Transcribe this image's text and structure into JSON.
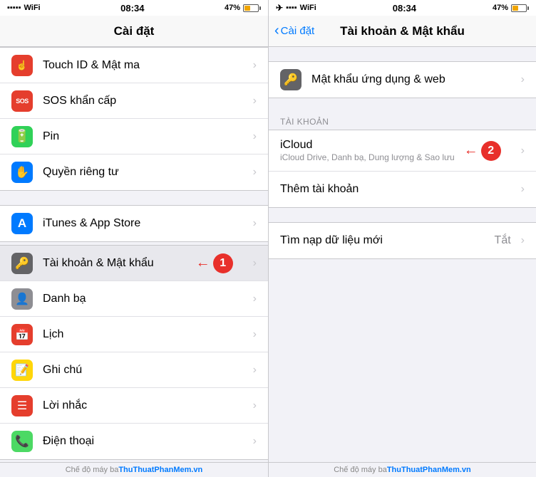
{
  "left_panel": {
    "status": {
      "time": "08:34",
      "battery_pct": "47%"
    },
    "nav_title": "Cài đặt",
    "items": [
      {
        "id": "touch-id",
        "label": "Touch ID & Mật ma",
        "icon_bg": "bg-red",
        "icon_char": "👆",
        "icon_unicode": "☝"
      },
      {
        "id": "sos",
        "label": "SOS khẩn cấp",
        "icon_bg": "bg-red",
        "icon_char": "SOS",
        "icon_type": "sos"
      },
      {
        "id": "pin",
        "label": "Pin",
        "icon_bg": "bg-green",
        "icon_char": "🔋",
        "icon_type": "battery"
      },
      {
        "id": "privacy",
        "label": "Quyền riêng tư",
        "icon_bg": "bg-blue",
        "icon_char": "✋",
        "icon_type": "hand"
      },
      {
        "id": "itunes",
        "label": "iTunes & App Store",
        "icon_bg": "bg-blue",
        "icon_char": "A",
        "icon_type": "appstore",
        "divider_before": true
      },
      {
        "id": "accounts",
        "label": "Tài khoản & Mật khẩu",
        "icon_bg": "bg-dark-gray",
        "icon_char": "🔑",
        "icon_type": "key",
        "active": true,
        "step": 1
      },
      {
        "id": "contacts",
        "label": "Danh bạ",
        "icon_bg": "bg-gray",
        "icon_char": "👤",
        "icon_type": "contacts"
      },
      {
        "id": "calendar",
        "label": "Lịch",
        "icon_bg": "bg-red",
        "icon_char": "📅",
        "icon_type": "calendar"
      },
      {
        "id": "notes",
        "label": "Ghi chú",
        "icon_bg": "bg-yellow",
        "icon_char": "📝",
        "icon_type": "notes"
      },
      {
        "id": "reminders",
        "label": "Lời nhắc",
        "icon_bg": "bg-red",
        "icon_char": "☰",
        "icon_type": "reminders"
      },
      {
        "id": "phone",
        "label": "Điện thoại",
        "icon_bg": "bg-green2",
        "icon_char": "📞",
        "icon_type": "phone"
      }
    ],
    "bottom_text": "Chế độ máy ba"
  },
  "right_panel": {
    "status": {
      "time": "08:34",
      "battery_pct": "47%"
    },
    "nav_back": "Cài đặt",
    "nav_title": "Tài khoản & Mật khẩu",
    "section_password": {
      "items": [
        {
          "id": "app-passwords",
          "label": "Mật khẩu ứng dụng & web",
          "icon_bg": "bg-dark-gray",
          "icon_char": "🔑",
          "icon_type": "key"
        }
      ]
    },
    "section_accounts": {
      "header": "TÀI KHOẢN",
      "items": [
        {
          "id": "icloud",
          "label": "iCloud",
          "sublabel": "iCloud Drive, Danh bạ, Dung lượng & Sao lưu",
          "step": 2
        },
        {
          "id": "add-account",
          "label": "Thêm tài khoản"
        }
      ]
    },
    "section_fetch": {
      "items": [
        {
          "id": "fetch-new",
          "label": "Tìm nạp dữ liệu mới",
          "value": "Tắt"
        }
      ]
    }
  },
  "watermark": {
    "prefix": "Chế độ máy ba",
    "brand": "ThuThuatPhanMem.vn"
  }
}
